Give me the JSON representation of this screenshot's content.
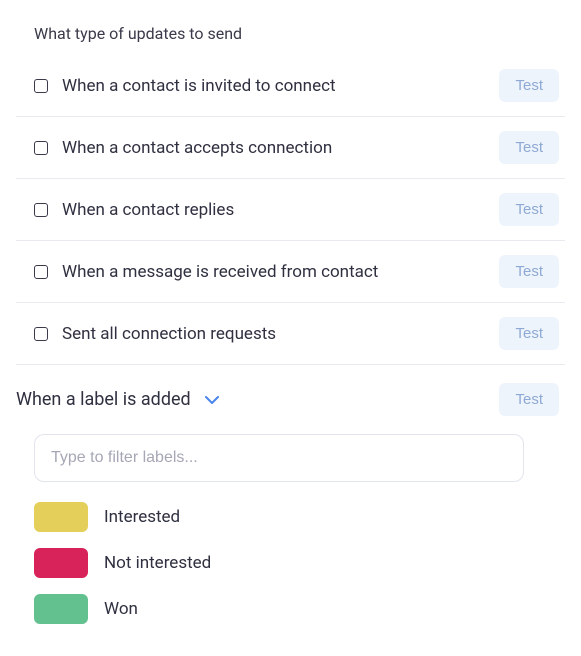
{
  "section_title": "What type of updates to send",
  "test_button_label": "Test",
  "updates": {
    "0": {
      "label": "When a contact is invited to connect"
    },
    "1": {
      "label": "When a contact accepts connection"
    },
    "2": {
      "label": "When a contact replies"
    },
    "3": {
      "label": "When a message is received from contact"
    },
    "4": {
      "label": "Sent all connection requests"
    }
  },
  "label_added": {
    "text": "When a label is added",
    "filter_placeholder": "Type to filter labels..."
  },
  "labels": {
    "0": {
      "name": "Interested",
      "color": "#e3cf5a"
    },
    "1": {
      "name": "Not interested",
      "color": "#d8235a"
    },
    "2": {
      "name": "Won",
      "color": "#63c08f"
    }
  }
}
